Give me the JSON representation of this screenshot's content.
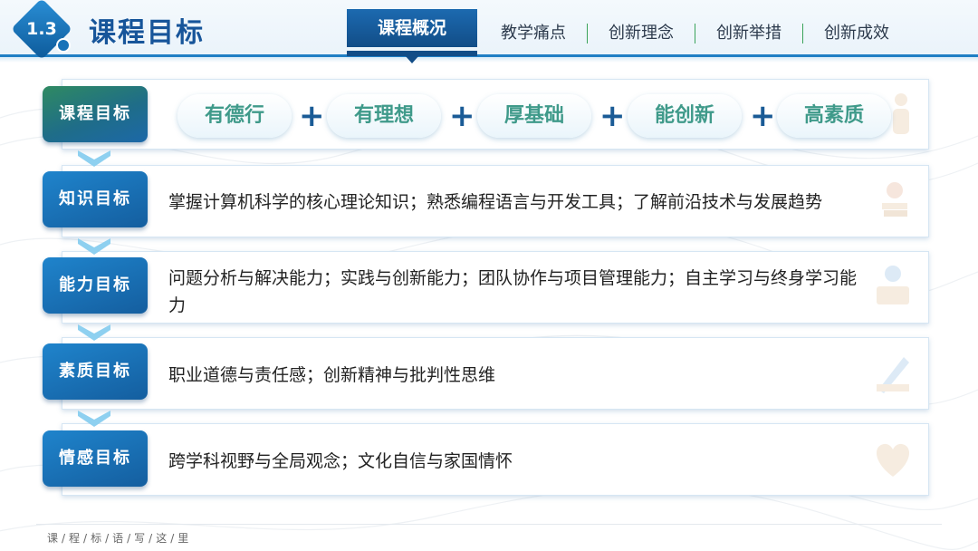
{
  "header": {
    "section_number": "1.3",
    "title": "课程目标",
    "tabs": [
      {
        "label": "课程概况",
        "active": true
      },
      {
        "label": "教学痛点",
        "active": false
      },
      {
        "label": "创新理念",
        "active": false
      },
      {
        "label": "创新举措",
        "active": false
      },
      {
        "label": "创新成效",
        "active": false
      }
    ]
  },
  "rows": [
    {
      "label": "课程目标",
      "pills": [
        "有德行",
        "有理想",
        "厚基础",
        "能创新",
        "高素质"
      ]
    },
    {
      "label": "知识目标",
      "text": "掌握计算机科学的核心理论知识；熟悉编程语言与开发工具；了解前沿技术与发展趋势"
    },
    {
      "label": "能力目标",
      "text": "问题分析与解决能力；实践与创新能力；团队协作与项目管理能力；自主学习与终身学习能力"
    },
    {
      "label": "素质目标",
      "text": "职业道德与责任感；创新精神与批判性思维"
    },
    {
      "label": "情感目标",
      "text": "跨学科视野与全局观念；文化自信与家国情怀"
    }
  ],
  "plus_symbol": "+",
  "footer": "课/程/标/语/写/这/里",
  "colors": {
    "primary": "#17559a",
    "accent": "#1f7fc4",
    "pill_text": "#3f9a8a",
    "separator": "#3aa35a"
  }
}
